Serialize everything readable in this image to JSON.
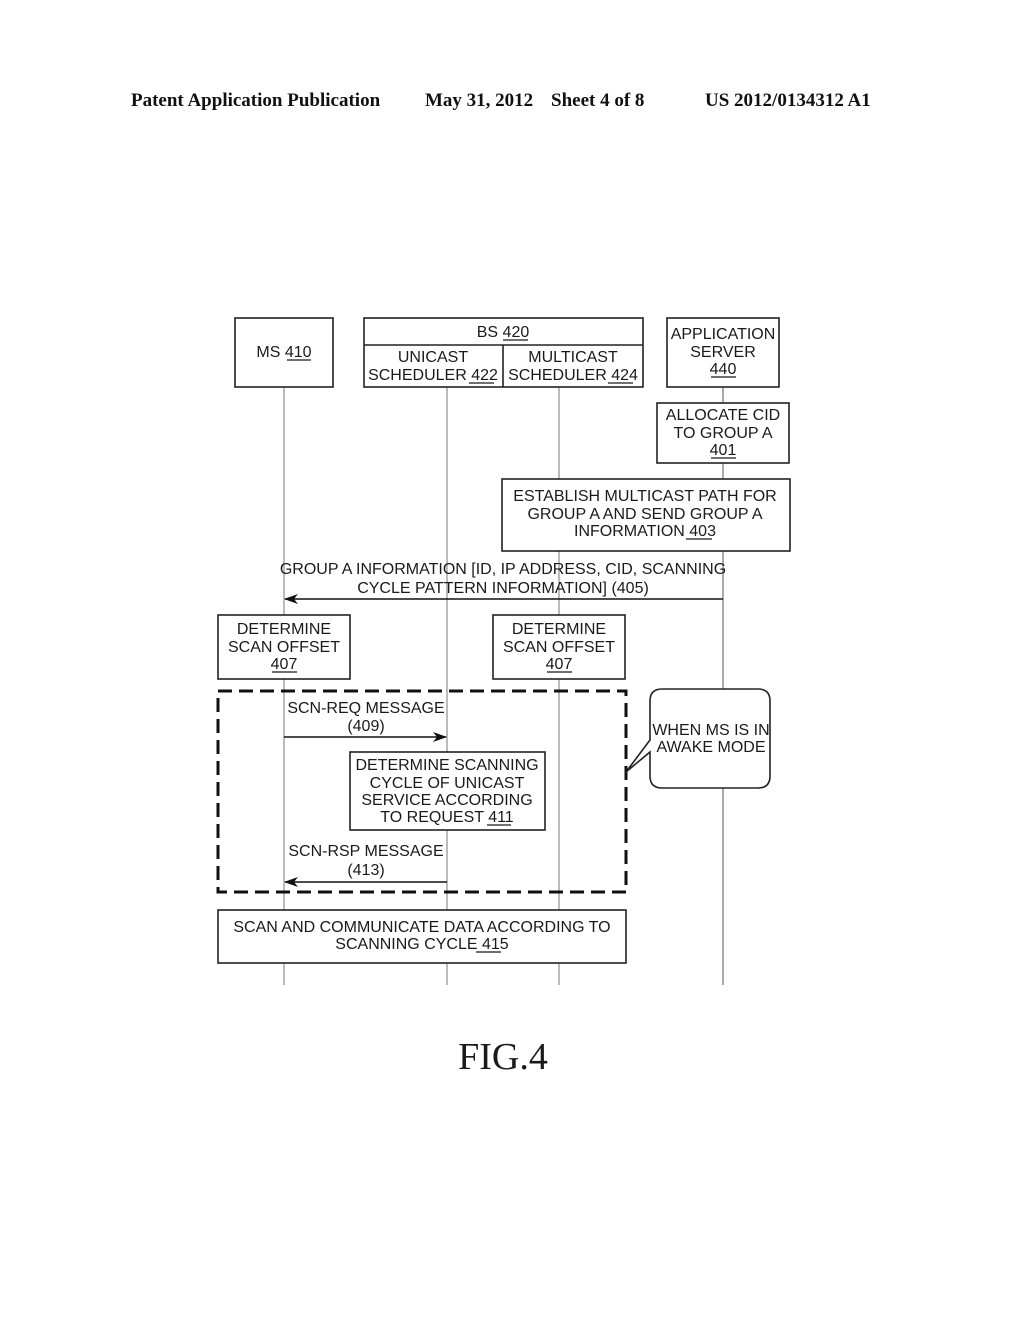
{
  "header": {
    "left": "Patent Application Publication",
    "date": "May 31, 2012",
    "sheet": "Sheet 4 of 8",
    "pub_number": "US 2012/0134312 A1"
  },
  "entities": {
    "ms": {
      "name": "MS",
      "ref": "410"
    },
    "bs": {
      "name": "BS",
      "ref": "420"
    },
    "unicast": {
      "line1": "UNICAST",
      "line2": "SCHEDULER",
      "ref": "422"
    },
    "multicast": {
      "line1": "MULTICAST",
      "line2": "SCHEDULER",
      "ref": "424"
    },
    "app_server": {
      "line1": "APPLICATION",
      "line2": "SERVER",
      "ref": "440"
    }
  },
  "steps": {
    "s401": {
      "line1": "ALLOCATE CID",
      "line2": "TO GROUP A",
      "ref": "401"
    },
    "s403": {
      "line1": "ESTABLISH MULTICAST PATH FOR",
      "line2": "GROUP A AND SEND GROUP A",
      "line3": "INFORMATION",
      "ref": "403"
    },
    "s405": {
      "line1": "GROUP A INFORMATION [ID, IP ADDRESS, CID, SCANNING",
      "line2": "CYCLE PATTERN INFORMATION] (405)"
    },
    "s407_ms": {
      "line1": "DETERMINE",
      "line2": "SCAN OFFSET",
      "ref": "407"
    },
    "s407_bs": {
      "line1": "DETERMINE",
      "line2": "SCAN OFFSET",
      "ref": "407"
    },
    "s409": {
      "line1": "SCN-REQ MESSAGE",
      "line2": "(409)"
    },
    "s411": {
      "line1": "DETERMINE SCANNING",
      "line2": "CYCLE OF UNICAST",
      "line3": "SERVICE ACCORDING",
      "line4": "TO REQUEST",
      "ref": "411"
    },
    "s413": {
      "line1": "SCN-RSP MESSAGE",
      "line2": "(413)"
    },
    "s415": {
      "line1": "SCAN AND COMMUNICATE DATA ACCORDING TO",
      "line2": "SCANNING CYCLE",
      "ref": "415"
    }
  },
  "callout": {
    "line1": "WHEN MS IS IN",
    "line2": "AWAKE MODE"
  },
  "figure_label": "FIG.4"
}
